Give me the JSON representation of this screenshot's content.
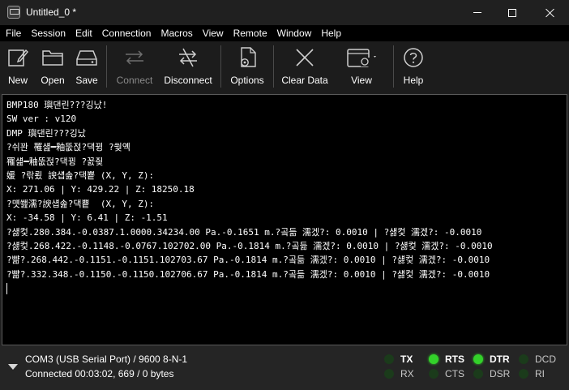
{
  "window": {
    "title": "Untitled_0 *"
  },
  "menu": [
    "File",
    "Session",
    "Edit",
    "Connection",
    "Macros",
    "View",
    "Remote",
    "Window",
    "Help"
  ],
  "toolbar": {
    "new_label": "New",
    "open_label": "Open",
    "save_label": "Save",
    "connect_label": "Connect",
    "disconnect_label": "Disconnect",
    "options_label": "Options",
    "clear_label": "Clear Data",
    "view_label": "View",
    "help_label": "Help"
  },
  "terminal": {
    "lines": [
      "BMP180 璵댄린???깅났!",
      "SW ver : v120",
      "DMP 璵댄린???깅났",
      "?쉬꽌 罹섎━釉뚮젅?댁뀡 ?쒖옉",
      "罹섎━釉뚮젅?댁뀡 ?꾨즺",
      "媛 ?띾룄 諛섑솚?댁뿉 (X, Y, Z):",
      "X: 271.06 | Y: 429.22 | Z: 18250.18",
      "?먯쐞濡?諛섑솚?댁뿉  (X, Y, Z):",
      "X: -34.58 | Y: 6.41 | Z: -1.51",
      "?섏컻.280.384.-0.0387.1.0000.34234.00 Pa.-0.1651 m.?곸듦 濡겠?: 0.0010 | ?섏컻 濡겠?: -0.0010",
      "?섏컻.268.422.-0.1148.-0.0767.102702.00 Pa.-0.1814 m.?곸듦 濡겠?: 0.0010 | ?섏컻 濡겠?: -0.0010",
      "?뺢?.268.442.-0.1151.-0.1151.102703.67 Pa.-0.1814 m.?곸듦 濡겠?: 0.0010 | ?섏컻 濡겠?: -0.0010",
      "?뺢?.332.348.-0.1150.-0.1150.102706.67 Pa.-0.1814 m.?곸듦 濡겠?: 0.0010 | ?섏컻 濡겠?: -0.0010"
    ]
  },
  "status": {
    "port": "COM3 (USB Serial Port) / 9600 8-N-1",
    "connection": "Connected 00:03:02, 669 / 0 bytes",
    "signals": {
      "tx": "TX",
      "rx": "RX",
      "rts": "RTS",
      "cts": "CTS",
      "dtr": "DTR",
      "dsr": "DSR",
      "dcd": "DCD",
      "ri": "RI"
    }
  },
  "colors": {
    "led_on": "#33d12a",
    "led_off": "#1b3b1b",
    "terminal_bg": "#000000"
  }
}
